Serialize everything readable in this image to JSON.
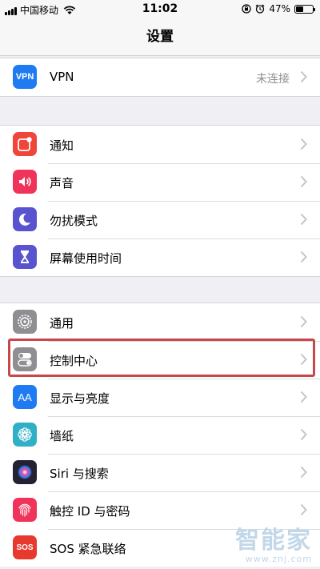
{
  "status_bar": {
    "carrier": "中国移动",
    "time": "11:02",
    "battery_text": "47%",
    "battery_level": 0.47
  },
  "nav": {
    "title": "设置"
  },
  "group1": [
    {
      "label": "VPN",
      "value": "未连接",
      "icon": "vpn-icon",
      "color": "#1f7bf2"
    }
  ],
  "group2": [
    {
      "label": "通知",
      "icon": "notifications-icon",
      "color": "#f0453a"
    },
    {
      "label": "声音",
      "icon": "sounds-icon",
      "color": "#f0335a"
    },
    {
      "label": "勿扰模式",
      "icon": "moon-icon",
      "color": "#5a53cf"
    },
    {
      "label": "屏幕使用时间",
      "icon": "hourglass-icon",
      "color": "#5a53cf"
    }
  ],
  "group3": [
    {
      "label": "通用",
      "icon": "gear-icon",
      "color": "#8e8e93"
    },
    {
      "label": "控制中心",
      "icon": "toggles-icon",
      "color": "#8e8e93"
    },
    {
      "label": "显示与亮度",
      "icon": "display-icon",
      "color": "#1f7bf2",
      "icon_text": "AA"
    },
    {
      "label": "墙纸",
      "icon": "wallpaper-icon",
      "color": "#30b0c7"
    },
    {
      "label": "Siri 与搜索",
      "icon": "siri-icon",
      "color": "#222233"
    },
    {
      "label": "触控 ID 与密码",
      "icon": "fingerprint-icon",
      "color": "#f0335a"
    },
    {
      "label": "SOS 紧急联络",
      "icon": "sos-icon",
      "color": "#e8392f",
      "icon_text": "SOS"
    }
  ],
  "watermark": {
    "title": "智能家",
    "url": "www.znj.com"
  }
}
